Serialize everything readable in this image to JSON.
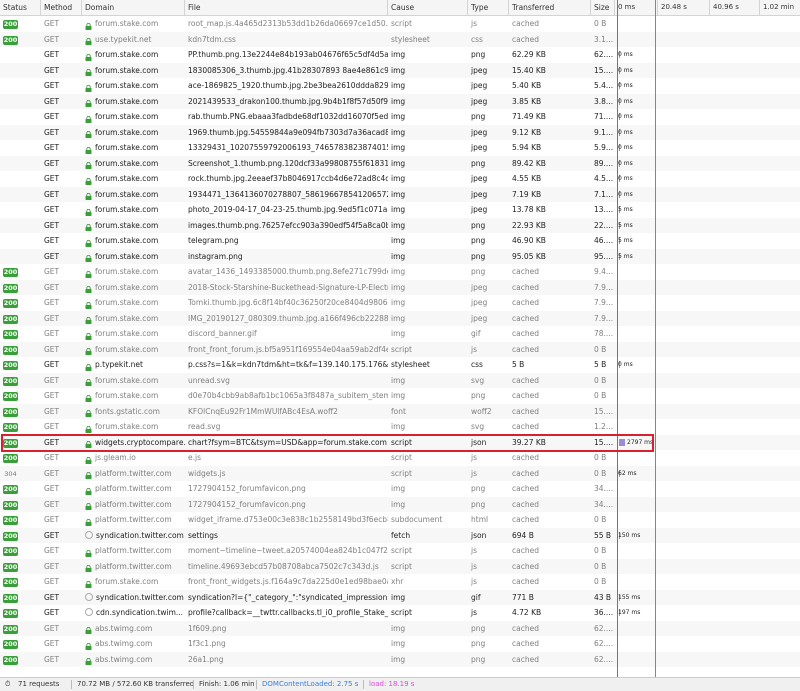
{
  "columns": {
    "status": "Status",
    "method": "Method",
    "domain": "Domain",
    "file": "File",
    "cause": "Cause",
    "type": "Type",
    "transferred": "Transferred",
    "size": "Size",
    "t0": "0 ms",
    "t1": "20.48 s",
    "t2": "40.96 s",
    "t3": "1.02 min"
  },
  "rows": [
    {
      "status": "200",
      "method": "GET",
      "domain": "forum.stake.com",
      "file": "root_map.js.4a465d2313b53dd1b26da06697ce1d50.js?v=9...",
      "cause": "script",
      "type": "js",
      "transferred": "cached",
      "size": "0 B",
      "timing": "",
      "cached": true,
      "icon": "lock"
    },
    {
      "status": "200",
      "method": "GET",
      "domain": "use.typekit.net",
      "file": "kdn7tdm.css",
      "cause": "stylesheet",
      "type": "css",
      "transferred": "cached",
      "size": "3.1...",
      "timing": "",
      "cached": true,
      "icon": "lock"
    },
    {
      "status": "",
      "method": "GET",
      "domain": "forum.stake.com",
      "file": "PP.thumb.png.13e2244e84b193ab04676f65c5df4d5a.png",
      "cause": "img",
      "type": "png",
      "transferred": "62.29 KB",
      "size": "62....",
      "timing": "0 ms",
      "cached": false,
      "icon": "lock"
    },
    {
      "status": "",
      "method": "GET",
      "domain": "forum.stake.com",
      "file": "1830085306_3.thumb.jpg.41b28307893 8ae4e861c97b4309c...",
      "cause": "img",
      "type": "jpeg",
      "transferred": "15.40 KB",
      "size": "15....",
      "timing": "0 ms",
      "cached": false,
      "icon": "lock"
    },
    {
      "status": "",
      "method": "GET",
      "domain": "forum.stake.com",
      "file": "ace-1869825_1920.thumb.jpg.2be3bea2610ddda8292cefc2...",
      "cause": "img",
      "type": "jpeg",
      "transferred": "5.40 KB",
      "size": "5.4...",
      "timing": "0 ms",
      "cached": false,
      "icon": "lock"
    },
    {
      "status": "",
      "method": "GET",
      "domain": "forum.stake.com",
      "file": "2021439533_drakon100.thumb.jpg.9b4b1f8f57d50f9dc67f1...",
      "cause": "img",
      "type": "jpeg",
      "transferred": "3.85 KB",
      "size": "3.8...",
      "timing": "0 ms",
      "cached": false,
      "icon": "lock"
    },
    {
      "status": "",
      "method": "GET",
      "domain": "forum.stake.com",
      "file": "rab.thumb.PNG.ebaaa3fadbde68df1032dd16070f5eda.PNG",
      "cause": "img",
      "type": "png",
      "transferred": "71.49 KB",
      "size": "71....",
      "timing": "0 ms",
      "cached": false,
      "icon": "lock"
    },
    {
      "status": "",
      "method": "GET",
      "domain": "forum.stake.com",
      "file": "1969.thumb.jpg.54559844a9e094fb7303d7a36acad826.jpg",
      "cause": "img",
      "type": "jpeg",
      "transferred": "9.12 KB",
      "size": "9.1...",
      "timing": "0 ms",
      "cached": false,
      "icon": "lock"
    },
    {
      "status": "",
      "method": "GET",
      "domain": "forum.stake.com",
      "file": "13329431_10207559792006193_7465783823874015404_o.th...",
      "cause": "img",
      "type": "jpeg",
      "transferred": "5.94 KB",
      "size": "5.9...",
      "timing": "0 ms",
      "cached": false,
      "icon": "lock"
    },
    {
      "status": "",
      "method": "GET",
      "domain": "forum.stake.com",
      "file": "Screenshot_1.thumb.png.120dcf33a99808755f618310cb0fb...",
      "cause": "img",
      "type": "png",
      "transferred": "89.42 KB",
      "size": "89....",
      "timing": "0 ms",
      "cached": false,
      "icon": "lock"
    },
    {
      "status": "",
      "method": "GET",
      "domain": "forum.stake.com",
      "file": "rock.thumb.jpg.2eeaef37b8046917ccb4d6e72ad8c4d2.jpg",
      "cause": "img",
      "type": "jpeg",
      "transferred": "4.55 KB",
      "size": "4.5...",
      "timing": "0 ms",
      "cached": false,
      "icon": "lock"
    },
    {
      "status": "",
      "method": "GET",
      "domain": "forum.stake.com",
      "file": "1934471_1364136070278807_5861966785412065724_n.thu...",
      "cause": "img",
      "type": "jpeg",
      "transferred": "7.19 KB",
      "size": "7.1...",
      "timing": "0 ms",
      "cached": false,
      "icon": "lock"
    },
    {
      "status": "",
      "method": "GET",
      "domain": "forum.stake.com",
      "file": "photo_2019-04-17_04-23-25.thumb.jpg.9ed5f1c071a864420...",
      "cause": "img",
      "type": "jpeg",
      "transferred": "13.78 KB",
      "size": "13....",
      "timing": "5 ms",
      "cached": false,
      "icon": "lock"
    },
    {
      "status": "",
      "method": "GET",
      "domain": "forum.stake.com",
      "file": "images.thumb.png.76257efcc903a390edf54f5a8ca0b20a.png",
      "cause": "img",
      "type": "png",
      "transferred": "22.93 KB",
      "size": "22....",
      "timing": "5 ms",
      "cached": false,
      "icon": "lock"
    },
    {
      "status": "",
      "method": "GET",
      "domain": "forum.stake.com",
      "file": "telegram.png",
      "cause": "img",
      "type": "png",
      "transferred": "46.90 KB",
      "size": "46....",
      "timing": "5 ms",
      "cached": false,
      "icon": "lock"
    },
    {
      "status": "",
      "method": "GET",
      "domain": "forum.stake.com",
      "file": "instagram.png",
      "cause": "img",
      "type": "png",
      "transferred": "95.05 KB",
      "size": "95....",
      "timing": "5 ms",
      "cached": false,
      "icon": "lock"
    },
    {
      "status": "200",
      "method": "GET",
      "domain": "forum.stake.com",
      "file": "avatar_1436_1493385000.thumb.png.8efe271c799ded2eaf3...",
      "cause": "img",
      "type": "png",
      "transferred": "cached",
      "size": "9.4...",
      "timing": "",
      "cached": true,
      "icon": "lock"
    },
    {
      "status": "200",
      "method": "GET",
      "domain": "forum.stake.com",
      "file": "2018-Stock-Starshine-Buckethead-Signature-LP-Electric-Gu...",
      "cause": "img",
      "type": "jpeg",
      "transferred": "cached",
      "size": "7.9...",
      "timing": "",
      "cached": true,
      "icon": "lock"
    },
    {
      "status": "200",
      "method": "GET",
      "domain": "forum.stake.com",
      "file": "Tomki.thumb.jpg.6c8f14bf40c36250f20ce8404d9806c9.jpg",
      "cause": "img",
      "type": "jpeg",
      "transferred": "cached",
      "size": "7.9...",
      "timing": "",
      "cached": true,
      "icon": "lock"
    },
    {
      "status": "200",
      "method": "GET",
      "domain": "forum.stake.com",
      "file": "IMG_20190127_080309.thumb.jpg.a166f496cb22288e6d208...",
      "cause": "img",
      "type": "jpeg",
      "transferred": "cached",
      "size": "7.9...",
      "timing": "",
      "cached": true,
      "icon": "lock"
    },
    {
      "status": "200",
      "method": "GET",
      "domain": "forum.stake.com",
      "file": "discord_banner.gif",
      "cause": "img",
      "type": "gif",
      "transferred": "cached",
      "size": "78....",
      "timing": "",
      "cached": true,
      "icon": "lock"
    },
    {
      "status": "200",
      "method": "GET",
      "domain": "forum.stake.com",
      "file": "front_front_forum.js.bf5a951f169554e04aa59ab2df4ef89a.j...",
      "cause": "script",
      "type": "js",
      "transferred": "cached",
      "size": "0 B",
      "timing": "",
      "cached": true,
      "icon": "lock"
    },
    {
      "status": "200",
      "method": "GET",
      "domain": "p.typekit.net",
      "file": "p.css?s=1&k=kdn7tdm&ht=tk&f=139.140.175.176&a=850...",
      "cause": "stylesheet",
      "type": "css",
      "transferred": "5 B",
      "size": "5 B",
      "timing": "0 ms",
      "cached": false,
      "icon": "lock"
    },
    {
      "status": "200",
      "method": "GET",
      "domain": "forum.stake.com",
      "file": "unread.svg",
      "cause": "img",
      "type": "svg",
      "transferred": "cached",
      "size": "0 B",
      "timing": "",
      "cached": true,
      "icon": "lock"
    },
    {
      "status": "200",
      "method": "GET",
      "domain": "forum.stake.com",
      "file": "d0e70b4cbb9ab8afb1bc1065a3f8487a_subitem_stem.png",
      "cause": "img",
      "type": "png",
      "transferred": "cached",
      "size": "0 B",
      "timing": "",
      "cached": true,
      "icon": "lock"
    },
    {
      "status": "200",
      "method": "GET",
      "domain": "fonts.gstatic.com",
      "file": "KFOlCnqEu92Fr1MmWUlfABc4EsA.woff2",
      "cause": "font",
      "type": "woff2",
      "transferred": "cached",
      "size": "15....",
      "timing": "",
      "cached": true,
      "icon": "lock"
    },
    {
      "status": "200",
      "method": "GET",
      "domain": "forum.stake.com",
      "file": "read.svg",
      "cause": "img",
      "type": "svg",
      "transferred": "cached",
      "size": "1.2...",
      "timing": "",
      "cached": true,
      "icon": "lock"
    },
    {
      "status": "200",
      "method": "GET",
      "domain": "widgets.cryptocompare.c...",
      "file": "chart?fsym=BTC&tsym=USD&app=forum.stake.com",
      "cause": "script",
      "type": "json",
      "transferred": "39.27 KB",
      "size": "15....",
      "timing": "2797 ms",
      "cached": false,
      "icon": "lock"
    },
    {
      "status": "200",
      "method": "GET",
      "domain": "js.gleam.io",
      "file": "e.js",
      "cause": "script",
      "type": "js",
      "transferred": "cached",
      "size": "0 B",
      "timing": "",
      "cached": true,
      "icon": "lock"
    },
    {
      "status": "304",
      "method": "GET",
      "domain": "platform.twitter.com",
      "file": "widgets.js",
      "cause": "script",
      "type": "js",
      "transferred": "cached",
      "size": "0 B",
      "timing": "62 ms",
      "cached": true,
      "icon": "lock"
    },
    {
      "status": "200",
      "method": "GET",
      "domain": "platform.twitter.com",
      "file": "1727904152_forumfavicon.png",
      "cause": "img",
      "type": "png",
      "transferred": "cached",
      "size": "34....",
      "timing": "",
      "cached": true,
      "icon": "lock"
    },
    {
      "status": "200",
      "method": "GET",
      "domain": "platform.twitter.com",
      "file": "1727904152_forumfavicon.png",
      "cause": "img",
      "type": "png",
      "transferred": "cached",
      "size": "34....",
      "timing": "",
      "cached": true,
      "icon": "lock"
    },
    {
      "status": "200",
      "method": "GET",
      "domain": "platform.twitter.com",
      "file": "widget_iframe.d753e00c3e838c1b2558149bd3f6ecb8.html?...",
      "cause": "subdocument",
      "type": "html",
      "transferred": "cached",
      "size": "0 B",
      "timing": "",
      "cached": true,
      "icon": "lock"
    },
    {
      "status": "200",
      "method": "GET",
      "domain": "syndication.twitter.com",
      "file": "settings",
      "cause": "fetch",
      "type": "json",
      "transferred": "694 B",
      "size": "55 B",
      "timing": "150 ms",
      "cached": false,
      "icon": "globe"
    },
    {
      "status": "200",
      "method": "GET",
      "domain": "platform.twitter.com",
      "file": "moment~timeline~tweet.a20574004ea824b1c047f200045ff...",
      "cause": "script",
      "type": "js",
      "transferred": "cached",
      "size": "0 B",
      "timing": "",
      "cached": true,
      "icon": "lock"
    },
    {
      "status": "200",
      "method": "GET",
      "domain": "platform.twitter.com",
      "file": "timeline.49693ebcd57b08708abca7502c7c343d.js",
      "cause": "script",
      "type": "js",
      "transferred": "cached",
      "size": "0 B",
      "timing": "",
      "cached": true,
      "icon": "lock"
    },
    {
      "status": "200",
      "method": "GET",
      "domain": "forum.stake.com",
      "file": "front_front_widgets.js.f164a9c7da225d0e1ed98bae0af2203...",
      "cause": "xhr",
      "type": "js",
      "transferred": "cached",
      "size": "0 B",
      "timing": "",
      "cached": true,
      "icon": "lock"
    },
    {
      "status": "200",
      "method": "GET",
      "domain": "syndication.twitter.com",
      "file": "syndication?l={\"_category_\":\"syndicated_impression\",\"trigg...",
      "cause": "img",
      "type": "gif",
      "transferred": "771 B",
      "size": "43 B",
      "timing": "155 ms",
      "cached": false,
      "icon": "globe"
    },
    {
      "status": "200",
      "method": "GET",
      "domain": "cdn.syndication.twim...",
      "file": "profile?callback=__twttr.callbacks.tl_i0_profile_Stake_old&...",
      "cause": "script",
      "type": "js",
      "transferred": "4.72 KB",
      "size": "36....",
      "timing": "197 ms",
      "cached": false,
      "icon": "globe"
    },
    {
      "status": "200",
      "method": "GET",
      "domain": "abs.twimg.com",
      "file": "1f609.png",
      "cause": "img",
      "type": "png",
      "transferred": "cached",
      "size": "62....",
      "timing": "",
      "cached": true,
      "icon": "lock"
    },
    {
      "status": "200",
      "method": "GET",
      "domain": "abs.twimg.com",
      "file": "1f3c1.png",
      "cause": "img",
      "type": "png",
      "transferred": "cached",
      "size": "62....",
      "timing": "",
      "cached": true,
      "icon": "lock"
    },
    {
      "status": "200",
      "method": "GET",
      "domain": "abs.twimg.com",
      "file": "26a1.png",
      "cause": "img",
      "type": "png",
      "transferred": "cached",
      "size": "62....",
      "timing": "",
      "cached": true,
      "icon": "lock"
    }
  ],
  "footer": {
    "requests": "71 requests",
    "transferred": "70.72 MB / 572.60 KB transferred",
    "finish": "Finish: 1.06 min",
    "dcl": "DOMContentLoaded: 2.75 s",
    "load": "load: 18.19 s"
  },
  "colors": {
    "ok_badge": "#3a9f3a",
    "timing_bar": "#9c8bd5",
    "dcl_line": "#3b7fd6",
    "load_line": "#d84ad8",
    "highlight": "#d8212f"
  }
}
